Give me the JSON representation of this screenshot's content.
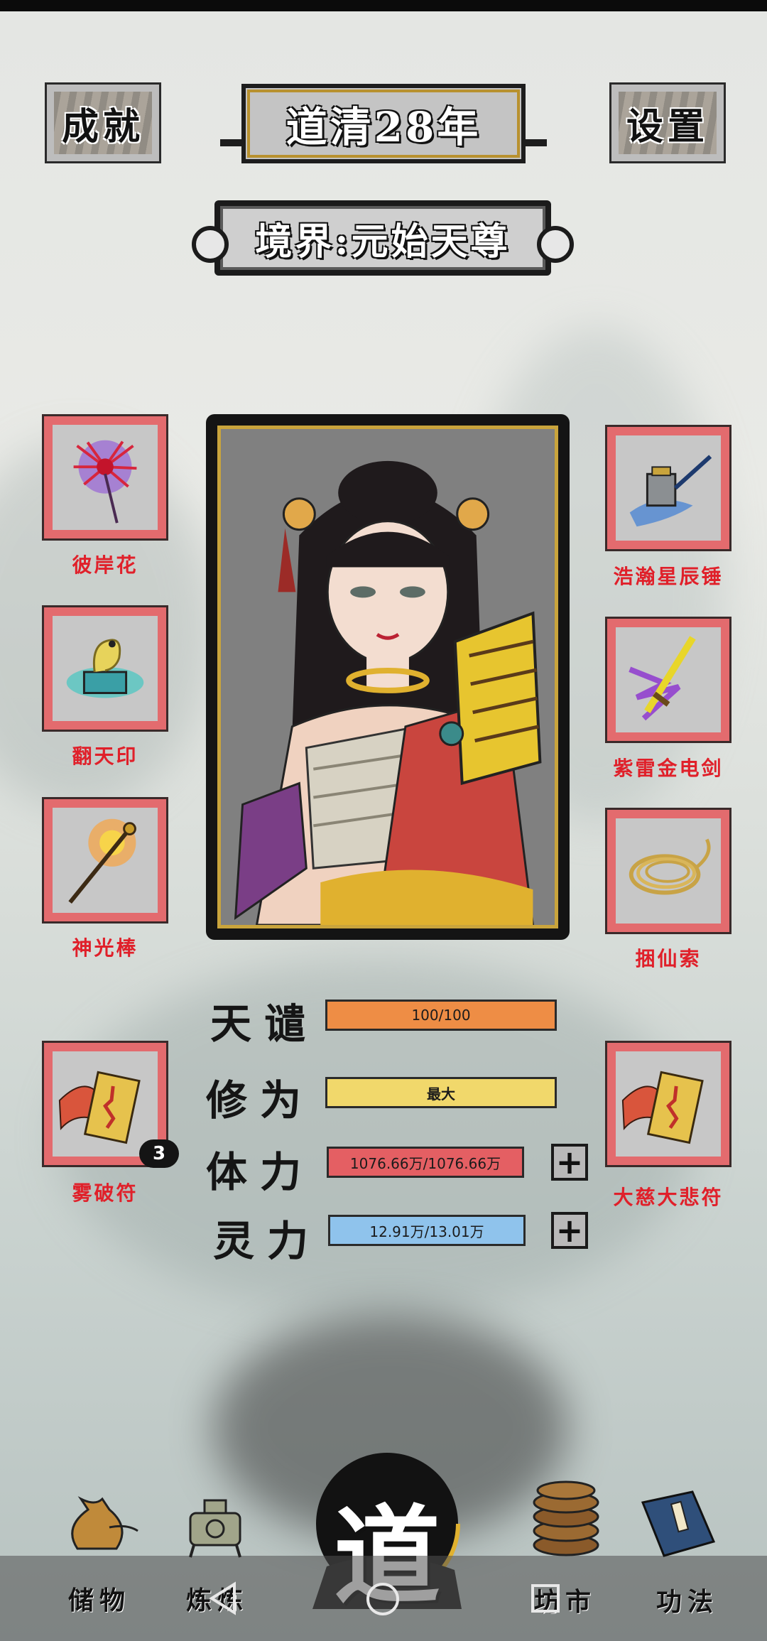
{
  "header": {
    "achievement_label": "成就",
    "year_label": "道清28年",
    "settings_label": "设置",
    "realm_label": "境界:元始天尊"
  },
  "left_items": [
    {
      "name": "彼岸花",
      "icon": "red-spider-lily-icon"
    },
    {
      "name": "翻天印",
      "icon": "dragon-seal-icon"
    },
    {
      "name": "神光棒",
      "icon": "golden-staff-icon"
    },
    {
      "name": "雾破符",
      "icon": "talisman-icon",
      "count": "3"
    }
  ],
  "right_items": [
    {
      "name": "浩瀚星辰锤",
      "icon": "star-hammer-icon"
    },
    {
      "name": "紫雷金电剑",
      "icon": "lightning-sword-icon"
    },
    {
      "name": "捆仙索",
      "icon": "rope-icon"
    },
    {
      "name": "大慈大悲符",
      "icon": "talisman-icon"
    }
  ],
  "stats": [
    {
      "label": "天谴",
      "value": "100/100",
      "color": "#ee8d45"
    },
    {
      "label": "修为",
      "value": "最大",
      "color": "#f1d86b"
    },
    {
      "label": "体力",
      "value": "1076.66万/1076.66万",
      "color": "#e45f63"
    },
    {
      "label": "灵力",
      "value": "12.91万/13.01万",
      "color": "#8fc3ec"
    }
  ],
  "center": {
    "emblem": "道"
  },
  "bottom_nav": {
    "storage": "储物",
    "refine": "炼炼",
    "market": "坊市",
    "skills": "功法"
  },
  "colors": {
    "slot_border": "#e36b6e",
    "item_label": "#e0202a",
    "portrait_gold": "#c9a43c"
  }
}
